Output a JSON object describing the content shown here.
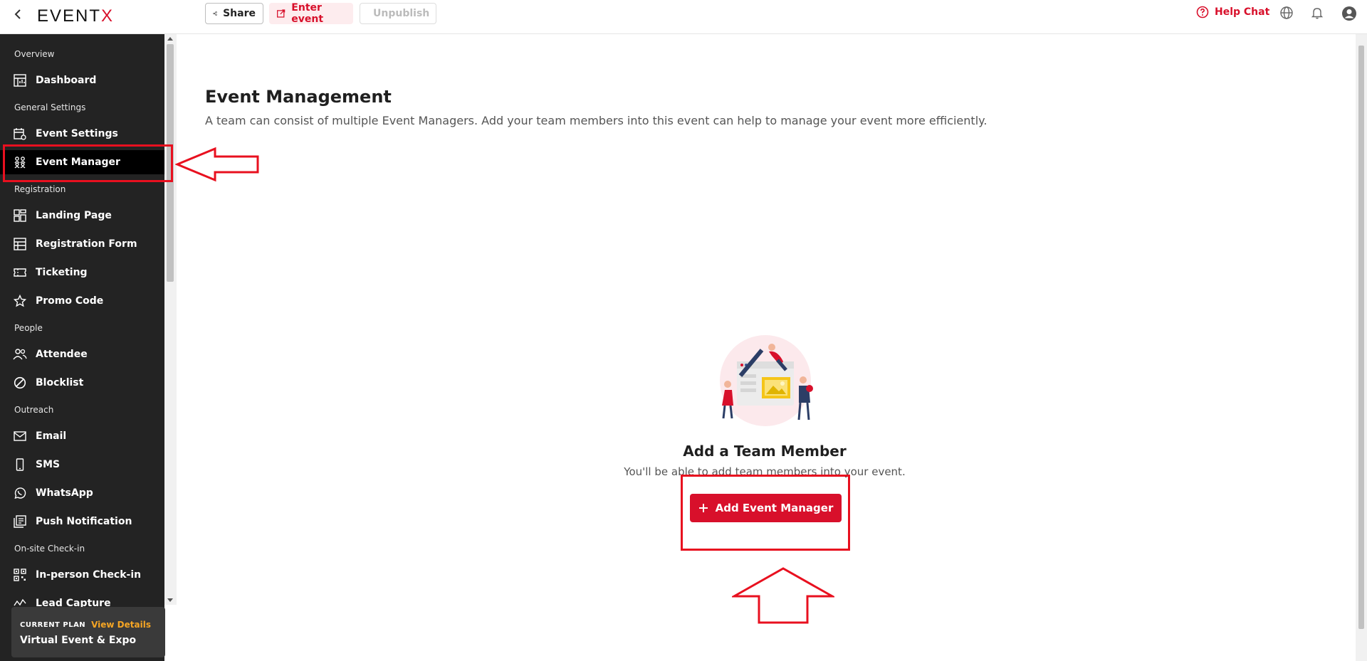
{
  "topbar": {
    "logo_main": "EVENT",
    "logo_x": "X",
    "share": "Share",
    "enter_event": "Enter event",
    "unpublish": "Unpublish",
    "help_chat": "Help Chat"
  },
  "sidebar": {
    "sections": {
      "overview": "Overview",
      "general": "General Settings",
      "registration": "Registration",
      "people": "People",
      "outreach": "Outreach",
      "onsite": "On-site Check-in"
    },
    "items": {
      "dashboard": "Dashboard",
      "event_settings": "Event Settings",
      "event_manager": "Event Manager",
      "landing_page": "Landing Page",
      "registration_form": "Registration Form",
      "ticketing": "Ticketing",
      "promo_code": "Promo Code",
      "attendee": "Attendee",
      "blocklist": "Blocklist",
      "email": "Email",
      "sms": "SMS",
      "whatsapp": "WhatsApp",
      "push_notification": "Push Notification",
      "inperson_checkin": "In-person Check-in",
      "lead_capture": "Lead Capture"
    },
    "plan": {
      "label": "CURRENT PLAN",
      "view_details": "View Details",
      "name": "Virtual Event & Expo"
    }
  },
  "main": {
    "title": "Event Management",
    "description": "A team can consist of multiple Event Managers. Add your team members into this event can help to manage your event more efficiently.",
    "empty_title": "Add a Team Member",
    "empty_subtitle": "You'll be able to add team members into your event.",
    "add_button": "Add Event Manager"
  },
  "colors": {
    "brand": "#d8102b",
    "sidebar_bg": "#232323",
    "annotation": "#e8101f"
  }
}
